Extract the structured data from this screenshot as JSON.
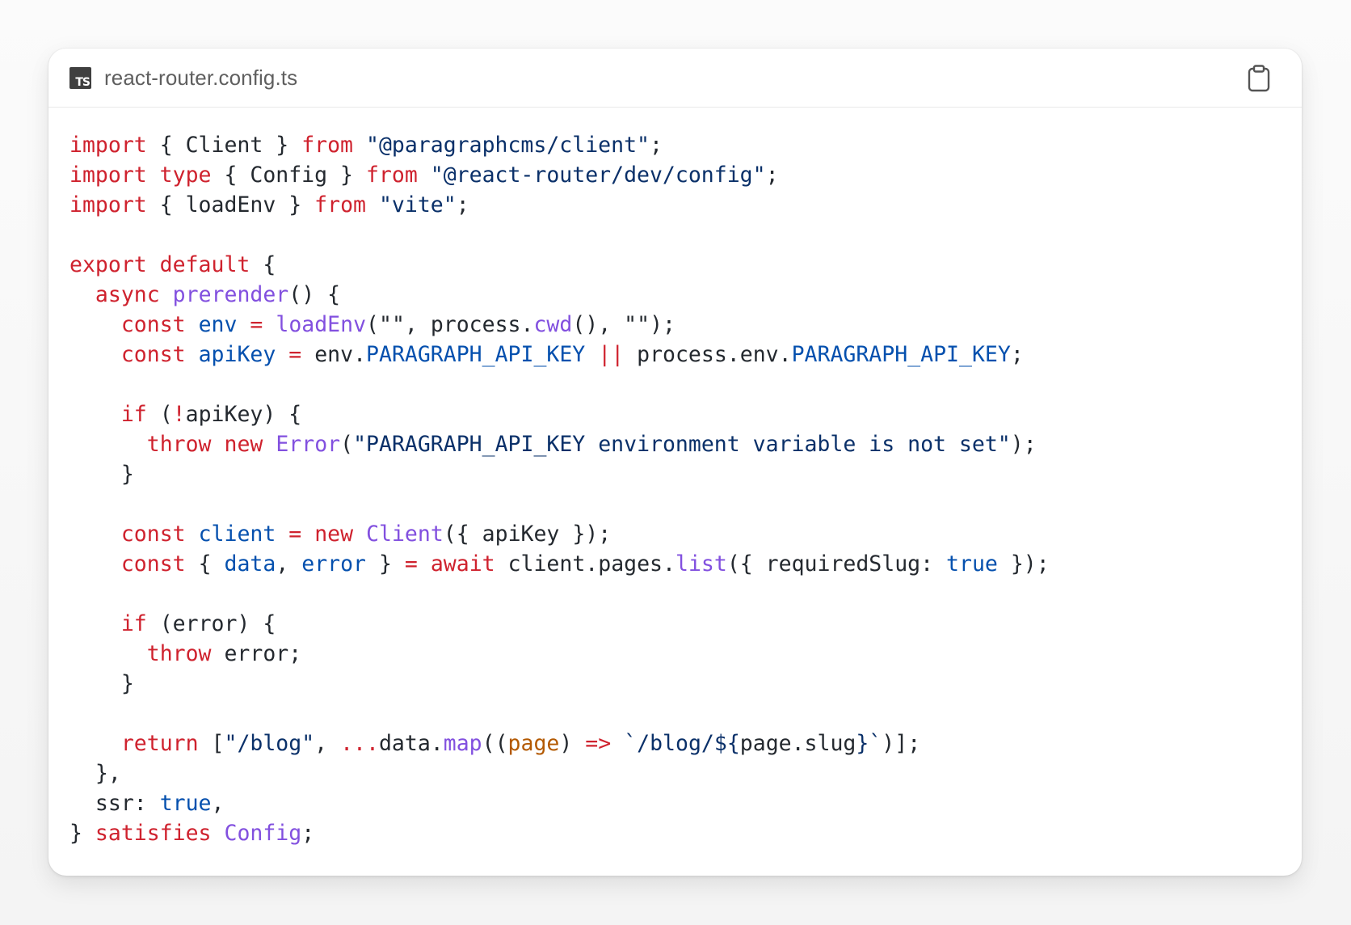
{
  "file": {
    "name": "react-router.config.ts",
    "icon": "typescript-file-icon",
    "icon_text": "TS"
  },
  "toolbar": {
    "copy_icon": "clipboard-icon"
  },
  "colors": {
    "keyword": "#cf222e",
    "string": "#0a3069",
    "function": "#8250df",
    "property": "#0550ae",
    "parameter": "#b35900",
    "text": "#24292f"
  },
  "code_lines": [
    [
      [
        "kw",
        "import"
      ],
      [
        "plain",
        " { Client } "
      ],
      [
        "kw",
        "from"
      ],
      [
        "plain",
        " "
      ],
      [
        "str",
        "\"@paragraphcms/client\""
      ],
      [
        "plain",
        ";"
      ]
    ],
    [
      [
        "kw",
        "import type"
      ],
      [
        "plain",
        " { Config } "
      ],
      [
        "kw",
        "from"
      ],
      [
        "plain",
        " "
      ],
      [
        "str",
        "\"@react-router/dev/config\""
      ],
      [
        "plain",
        ";"
      ]
    ],
    [
      [
        "kw",
        "import"
      ],
      [
        "plain",
        " { loadEnv } "
      ],
      [
        "kw",
        "from"
      ],
      [
        "plain",
        " "
      ],
      [
        "str",
        "\"vite\""
      ],
      [
        "plain",
        ";"
      ]
    ],
    [],
    [
      [
        "kw",
        "export default"
      ],
      [
        "plain",
        " {"
      ]
    ],
    [
      [
        "plain",
        "  "
      ],
      [
        "kw",
        "async"
      ],
      [
        "plain",
        " "
      ],
      [
        "fn",
        "prerender"
      ],
      [
        "plain",
        "() {"
      ]
    ],
    [
      [
        "plain",
        "    "
      ],
      [
        "kw",
        "const"
      ],
      [
        "plain",
        " "
      ],
      [
        "prop",
        "env"
      ],
      [
        "plain",
        " "
      ],
      [
        "kw",
        "="
      ],
      [
        "plain",
        " "
      ],
      [
        "fn",
        "loadEnv"
      ],
      [
        "plain",
        "(\"\", process."
      ],
      [
        "fn",
        "cwd"
      ],
      [
        "plain",
        "(), \"\");"
      ]
    ],
    [
      [
        "plain",
        "    "
      ],
      [
        "kw",
        "const"
      ],
      [
        "plain",
        " "
      ],
      [
        "prop",
        "apiKey"
      ],
      [
        "plain",
        " "
      ],
      [
        "kw",
        "="
      ],
      [
        "plain",
        " env."
      ],
      [
        "prop",
        "PARAGRAPH_API_KEY"
      ],
      [
        "plain",
        " "
      ],
      [
        "kw",
        "||"
      ],
      [
        "plain",
        " process.env."
      ],
      [
        "prop",
        "PARAGRAPH_API_KEY"
      ],
      [
        "plain",
        ";"
      ]
    ],
    [],
    [
      [
        "plain",
        "    "
      ],
      [
        "kw",
        "if"
      ],
      [
        "plain",
        " ("
      ],
      [
        "kw",
        "!"
      ],
      [
        "plain",
        "apiKey) {"
      ]
    ],
    [
      [
        "plain",
        "      "
      ],
      [
        "kw",
        "throw"
      ],
      [
        "plain",
        " "
      ],
      [
        "kw",
        "new"
      ],
      [
        "plain",
        " "
      ],
      [
        "fn",
        "Error"
      ],
      [
        "plain",
        "("
      ],
      [
        "str",
        "\"PARAGRAPH_API_KEY environment variable is not set\""
      ],
      [
        "plain",
        ");"
      ]
    ],
    [
      [
        "plain",
        "    }"
      ]
    ],
    [],
    [
      [
        "plain",
        "    "
      ],
      [
        "kw",
        "const"
      ],
      [
        "plain",
        " "
      ],
      [
        "prop",
        "client"
      ],
      [
        "plain",
        " "
      ],
      [
        "kw",
        "="
      ],
      [
        "plain",
        " "
      ],
      [
        "kw",
        "new"
      ],
      [
        "plain",
        " "
      ],
      [
        "fn",
        "Client"
      ],
      [
        "plain",
        "({ apiKey });"
      ]
    ],
    [
      [
        "plain",
        "    "
      ],
      [
        "kw",
        "const"
      ],
      [
        "plain",
        " { "
      ],
      [
        "prop",
        "data"
      ],
      [
        "plain",
        ", "
      ],
      [
        "prop",
        "error"
      ],
      [
        "plain",
        " } "
      ],
      [
        "kw",
        "="
      ],
      [
        "plain",
        " "
      ],
      [
        "kw",
        "await"
      ],
      [
        "plain",
        " client.pages."
      ],
      [
        "fn",
        "list"
      ],
      [
        "plain",
        "({ requiredSlug: "
      ],
      [
        "prop",
        "true"
      ],
      [
        "plain",
        " });"
      ]
    ],
    [],
    [
      [
        "plain",
        "    "
      ],
      [
        "kw",
        "if"
      ],
      [
        "plain",
        " (error) {"
      ]
    ],
    [
      [
        "plain",
        "      "
      ],
      [
        "kw",
        "throw"
      ],
      [
        "plain",
        " error;"
      ]
    ],
    [
      [
        "plain",
        "    }"
      ]
    ],
    [],
    [
      [
        "plain",
        "    "
      ],
      [
        "kw",
        "return"
      ],
      [
        "plain",
        " ["
      ],
      [
        "str",
        "\"/blog\""
      ],
      [
        "plain",
        ", "
      ],
      [
        "kw",
        "..."
      ],
      [
        "plain",
        "data."
      ],
      [
        "fn",
        "map"
      ],
      [
        "plain",
        "(("
      ],
      [
        "param",
        "page"
      ],
      [
        "plain",
        ") "
      ],
      [
        "kw",
        "=>"
      ],
      [
        "plain",
        " "
      ],
      [
        "str",
        "`/blog/${"
      ],
      [
        "plain",
        "page.slug"
      ],
      [
        "str",
        "}`"
      ],
      [
        "plain",
        ")];"
      ]
    ],
    [
      [
        "plain",
        "  },"
      ]
    ],
    [
      [
        "plain",
        "  ssr: "
      ],
      [
        "prop",
        "true"
      ],
      [
        "plain",
        ","
      ]
    ],
    [
      [
        "plain",
        "} "
      ],
      [
        "kw",
        "satisfies"
      ],
      [
        "plain",
        " "
      ],
      [
        "fn",
        "Config"
      ],
      [
        "plain",
        ";"
      ]
    ]
  ]
}
